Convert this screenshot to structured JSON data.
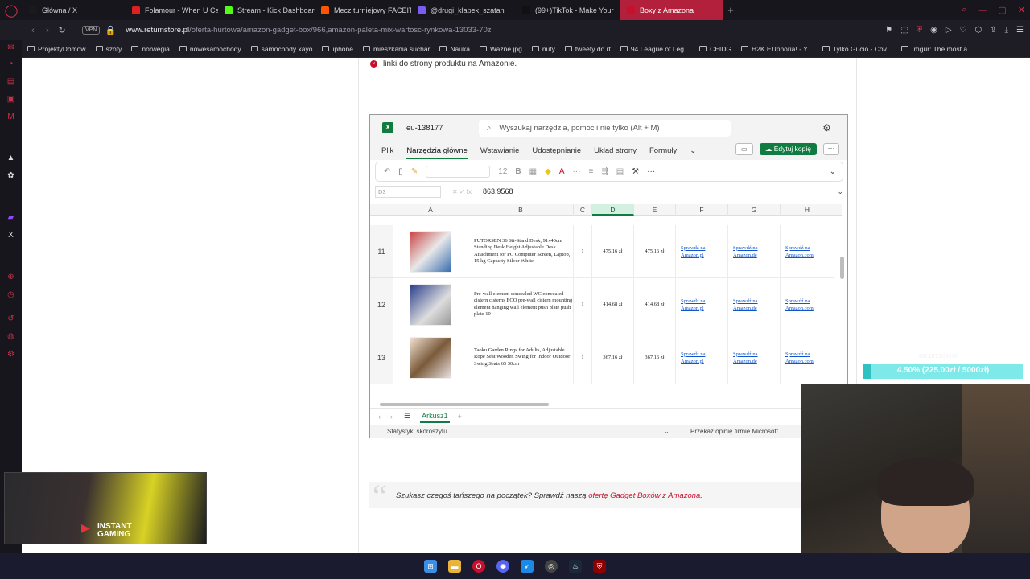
{
  "browser": {
    "tabs": [
      {
        "label": "Główna / X",
        "color": "#1a1a1a"
      },
      {
        "label": "Folamour - When U Came",
        "color": "#e02020"
      },
      {
        "label": "Stream - Kick Dashboard",
        "color": "#53fc18"
      },
      {
        "label": "Mecz turniejowy FACEIT",
        "color": "#ff5500"
      },
      {
        "label": "@drugi_klapek_szatan",
        "color": "#7b5cf0"
      },
      {
        "label": "(99+)TikTok - Make Your",
        "color": "#111111"
      },
      {
        "label": "Boxy z Amazona",
        "color": "#c8102e",
        "active": true
      }
    ],
    "vpn": "VPN",
    "url_domain": "www.returnstore.pl",
    "url_path": "/oferta-hurtowa/amazon-gadget-box/966,amazon-paleta-mix-wartosc-rynkowa-13033-70zl",
    "bookmarks": [
      {
        "label": "ProjektyDomow"
      },
      {
        "label": "szoty"
      },
      {
        "label": "norwegia"
      },
      {
        "label": "nowesamochody"
      },
      {
        "label": "samochody xayo"
      },
      {
        "label": "iphone"
      },
      {
        "label": "mieszkania suchar"
      },
      {
        "label": "Nauka"
      },
      {
        "label": "Ważne.jpg"
      },
      {
        "label": "nuty"
      },
      {
        "label": "tweety do rt"
      },
      {
        "label": "94 League of Leg..."
      },
      {
        "label": "CEIDG"
      },
      {
        "label": "H2K EUphoria! - Y..."
      },
      {
        "label": "Tylko Gucio - Cov..."
      },
      {
        "label": "Imgur: The most a..."
      }
    ]
  },
  "page": {
    "bullet_text": "linki do strony produktu na Amazonie.",
    "quote_text_prefix": "Szukasz czegoś tańszego na początek? Sprawdź naszą ",
    "quote_link": "ofertę Gadget Boxów z Amazona",
    "quote_text_suffix": "."
  },
  "excel": {
    "file_name": "eu-138177",
    "search_placeholder": "Wyszukaj narzędzia, pomoc i nie tylko (Alt + M)",
    "menu": [
      "Plik",
      "Narzędzia główne",
      "Wstawianie",
      "Udostępnianie",
      "Układ strony",
      "Formuły"
    ],
    "active_menu": "Narzędzia główne",
    "edit_button": "Edytuj kopię",
    "font_size": "12",
    "name_box": "D3",
    "formula_value": "863,9568",
    "columns": [
      "A",
      "B",
      "C",
      "D",
      "E",
      "F",
      "G",
      "H"
    ],
    "selected_column": "D",
    "rows": [
      {
        "num": "11",
        "desc": "PUTORSEN 36 Sit-Stand Desk, 91x40cm Standing Desk Height Adjustable Desk Attachment for PC Computer Screen, Laptop, 15 kg Capacity Silver White",
        "qty": "1",
        "price": "475,16 zł",
        "total": "475,16 zł",
        "link_pl": "Sprawdź na Amazon.pl",
        "link_de": "Sprawdź na Amazon.de",
        "link_com": "Sprawdź na Amazon.com"
      },
      {
        "num": "12",
        "desc": "Pre-wall element concealed WC concealed cistern cisterns ECO pre-wall cistern mounting element hanging wall element push plate push plate 10",
        "qty": "1",
        "price": "414,68 zł",
        "total": "414,68 zł",
        "link_pl": "Sprawdź na Amazon.pl",
        "link_de": "Sprawdź na Amazon.de",
        "link_com": "Sprawdź na Amazon.com"
      },
      {
        "num": "13",
        "desc": "Taoku Garden Rings for Adults, Adjustable Rope Seat Wooden Swing for Indoor Outdoor Swing Seats 65 30cm",
        "qty": "1",
        "price": "367,16 zł",
        "total": "367,16 zł",
        "link_pl": "Sprawdź na Amazon.pl",
        "link_de": "Sprawdź na Amazon.de",
        "link_com": "Sprawdź na Amazon.com"
      }
    ],
    "sheet_name": "Arkusz1",
    "status_left": "Statystyki skoroszytu",
    "status_right": "Przekaż opinię firmie Microsoft"
  },
  "overlay": {
    "ad_text": "INSTANT GAMING",
    "donation_label": "na przejście",
    "donation_text": "4.50% (225.00zł / 5000zł)",
    "donation_progress": 0.045
  }
}
